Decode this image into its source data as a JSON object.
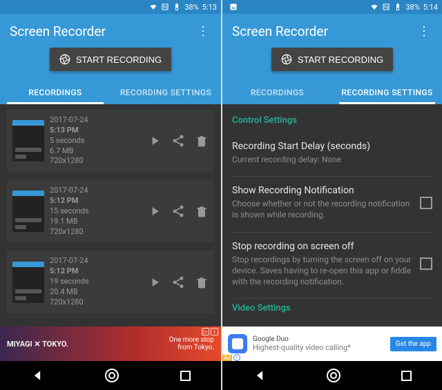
{
  "left": {
    "status": {
      "battery": "38%",
      "time": "5:13"
    },
    "app_title": "Screen Recorder",
    "start_button": "START RECORDING",
    "tabs": {
      "recordings": "RECORDINGS",
      "settings": "RECORDING SETTINGS",
      "active": "recordings"
    },
    "recordings": [
      {
        "date": "2017-07-24",
        "time": "5:13 PM",
        "duration": "5 seconds",
        "size": "6.7 MB",
        "res": "720x1280"
      },
      {
        "date": "2017-07-24",
        "time": "5:12 PM",
        "duration": "15 seconds",
        "size": "19.1 MB",
        "res": "720x1280"
      },
      {
        "date": "2017-07-24",
        "time": "5:12 PM",
        "duration": "19 seconds",
        "size": "20.4 MB",
        "res": "720x1280"
      }
    ],
    "ad": {
      "title": "MIYAGI ✕ TOKYO.",
      "line1": "One more stop",
      "line2": "from Tokyo."
    }
  },
  "right": {
    "status": {
      "battery": "38%",
      "time": "5:14"
    },
    "app_title": "Screen Recorder",
    "start_button": "START RECORDING",
    "tabs": {
      "recordings": "RECORDINGS",
      "settings": "RECORDING SETTINGS",
      "active": "settings"
    },
    "sections": {
      "control": "Control Settings",
      "video": "Video Settings"
    },
    "items": [
      {
        "title": "Recording Start Delay (seconds)",
        "sub": "Current recording delay: None",
        "checkbox": false
      },
      {
        "title": "Show Recording Notification",
        "sub": "Choose whether or not the recording notification is shown while recording.",
        "checkbox": true
      },
      {
        "title": "Stop recording on screen off",
        "sub": "Stop recordings by turning the screen off on your device. Saves having to re-open this app or fiddle with the recording notification.",
        "checkbox": true
      }
    ],
    "ad": {
      "app": "Google Duo",
      "text": "Highest-quality video calling*",
      "cta": "Get the app",
      "label": "Ad"
    }
  }
}
